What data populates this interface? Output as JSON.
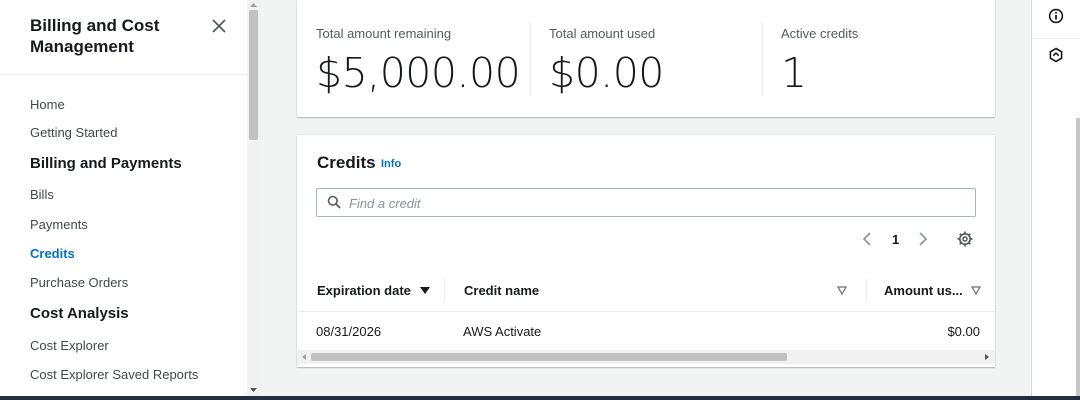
{
  "sidebar": {
    "title": "Billing and Cost Management",
    "items": [
      {
        "label": "Home",
        "kind": "link"
      },
      {
        "label": "Getting Started",
        "kind": "link"
      },
      {
        "label": "Billing and Payments",
        "kind": "section"
      },
      {
        "label": "Bills",
        "kind": "link"
      },
      {
        "label": "Payments",
        "kind": "link"
      },
      {
        "label": "Credits",
        "kind": "link",
        "active": true
      },
      {
        "label": "Purchase Orders",
        "kind": "link"
      },
      {
        "label": "Cost Analysis",
        "kind": "section"
      },
      {
        "label": "Cost Explorer",
        "kind": "link"
      },
      {
        "label": "Cost Explorer Saved Reports",
        "kind": "link"
      }
    ]
  },
  "summary": {
    "stats": [
      {
        "label": "Total amount remaining",
        "value": "$5,000.00"
      },
      {
        "label": "Total amount used",
        "value": "$0.00"
      },
      {
        "label": "Active credits",
        "value": "1"
      }
    ]
  },
  "credits": {
    "title": "Credits",
    "info_label": "Info",
    "search_placeholder": "Find a credit",
    "page": "1",
    "columns": [
      "Expiration date",
      "Credit name",
      "Amount us..."
    ],
    "rows": [
      {
        "expiration": "08/31/2026",
        "name": "AWS Activate",
        "amount": "$0.00"
      }
    ]
  },
  "icons": {
    "close": "close-icon",
    "search": "search-icon",
    "prev": "chevron-left-icon",
    "next": "chevron-right-icon",
    "settings": "gear-icon",
    "info": "info-icon",
    "secondary": "hexagon-icon"
  },
  "colors": {
    "accent": "#0073bb",
    "background": "#f2f3f3",
    "text": "#16191f"
  }
}
